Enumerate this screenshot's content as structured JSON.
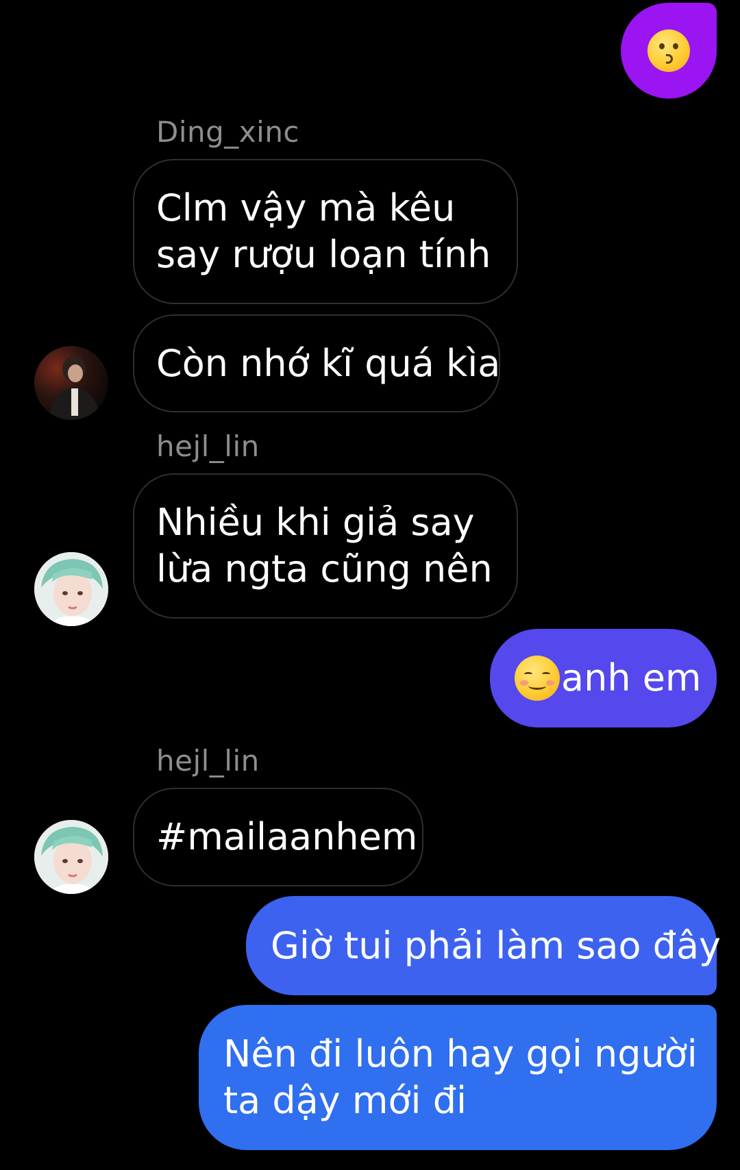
{
  "messages": [
    {
      "direction": "outgoing",
      "type": "emoji",
      "emoji": "kissing-face"
    },
    {
      "direction": "incoming",
      "sender": "Ding_xinc",
      "lines": [
        "Clm vậy mà kêu",
        "say rượu loạn tính"
      ]
    },
    {
      "direction": "incoming",
      "lines": [
        "Còn nhớ kĩ quá kìa"
      ]
    },
    {
      "direction": "incoming",
      "sender": "hejl_lin",
      "lines": [
        "Nhiều khi giả say",
        "lừa ngta cũng nên"
      ]
    },
    {
      "direction": "outgoing",
      "emoji": "smiling-face-with-blush",
      "text": "anh em"
    },
    {
      "direction": "incoming",
      "sender": "hejl_lin",
      "lines": [
        "#mailaanhem"
      ]
    },
    {
      "direction": "outgoing",
      "lines": [
        "Giờ tui phải làm sao đây"
      ]
    },
    {
      "direction": "outgoing",
      "lines": [
        "Nên đi luôn hay gọi người",
        "ta dậy mới đi"
      ]
    }
  ],
  "colors": {
    "background": "#000000",
    "incoming_border": "#2f2f2f",
    "sender_name": "#8e8e8e",
    "outgoing_purple": "#9b14f2",
    "outgoing_indigo": "#5548ec",
    "outgoing_blue_1": "#3d62ef",
    "outgoing_blue_2": "#2f6ff0"
  }
}
